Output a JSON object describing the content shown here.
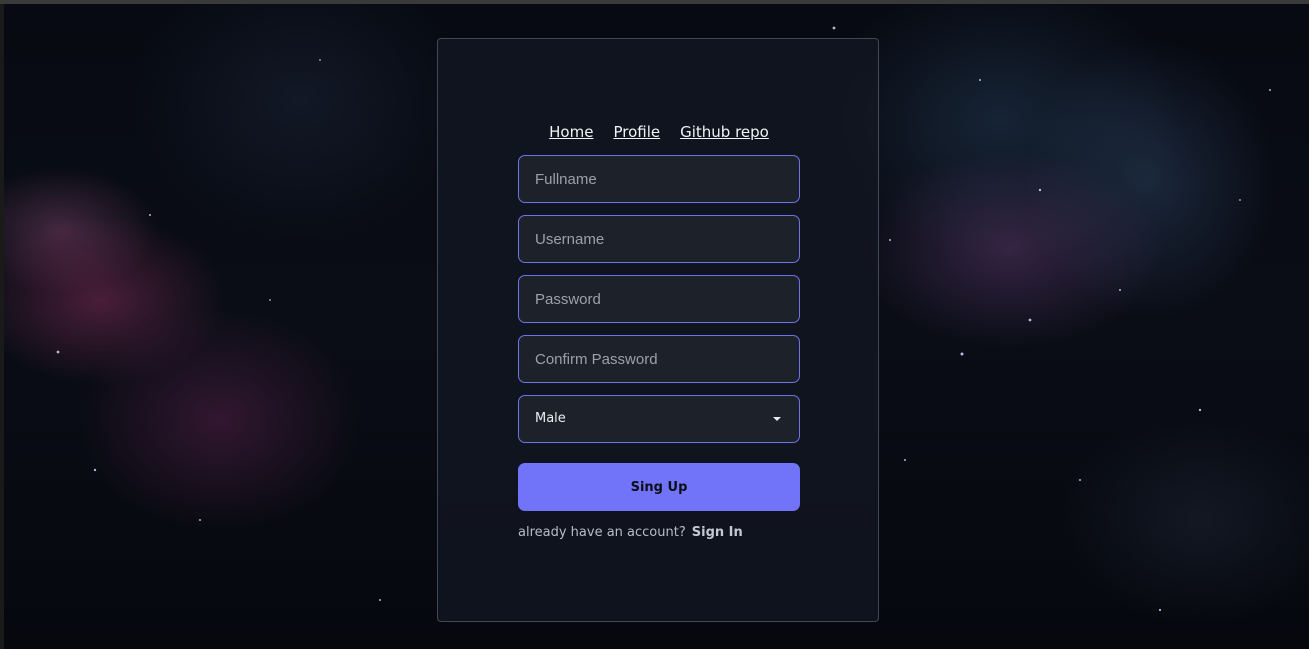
{
  "nav": {
    "home": "Home",
    "profile": "Profile",
    "github": "Github repo"
  },
  "form": {
    "fullname_placeholder": "Fullname",
    "username_placeholder": "Username",
    "password_placeholder": "Password",
    "confirm_password_placeholder": "Confirm Password",
    "gender_selected": "Male",
    "submit_label": "Sing Up",
    "account_prompt": "already have an account?",
    "signin_label": "Sign In"
  },
  "colors": {
    "accent": "#7174f8",
    "input_border": "#6f73e6",
    "input_bg": "#1d2129"
  }
}
